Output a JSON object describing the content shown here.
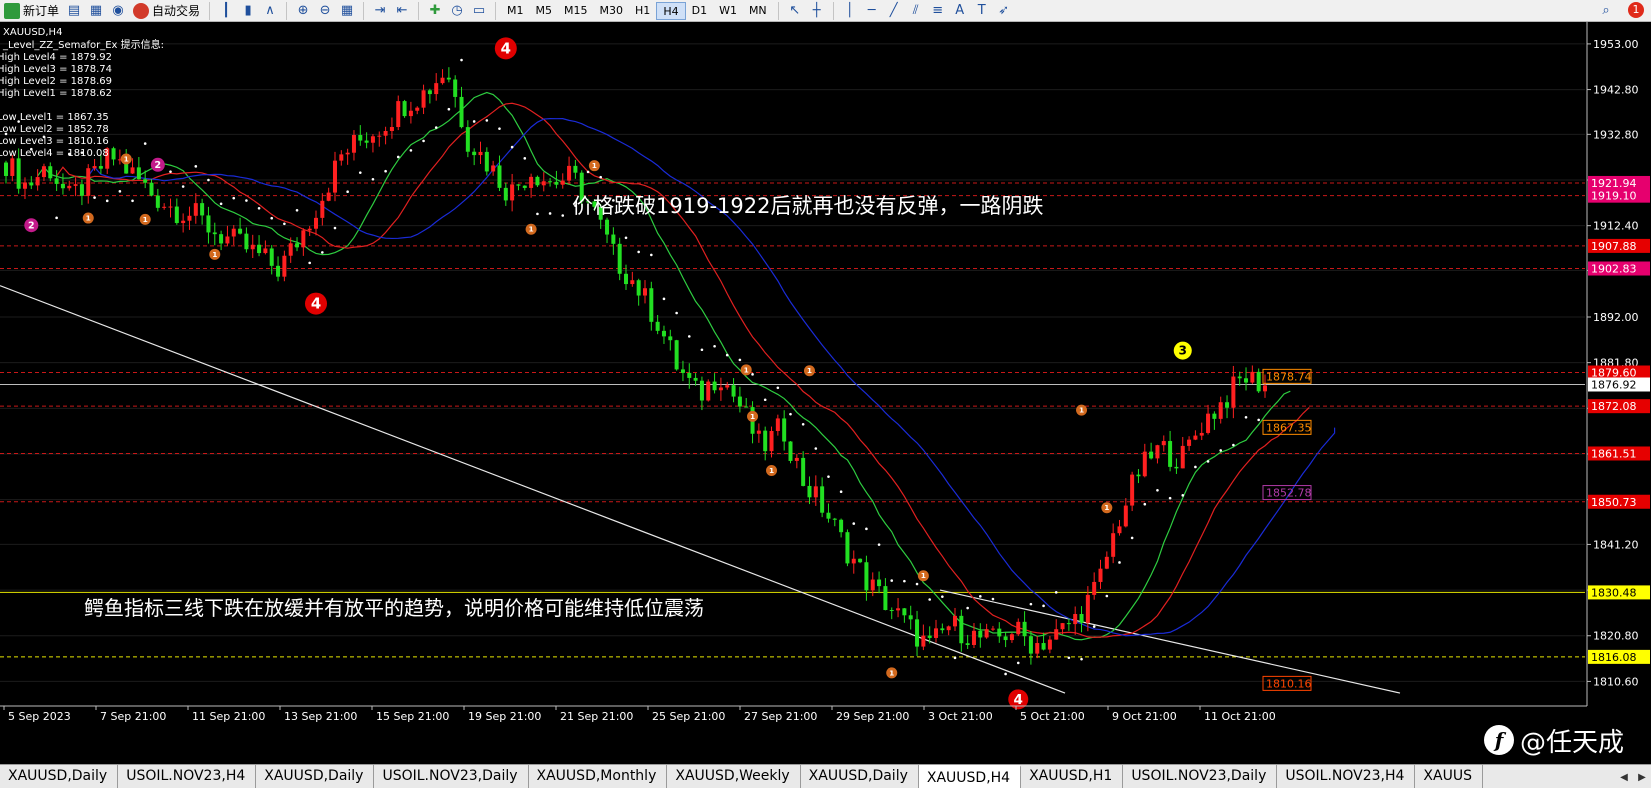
{
  "toolbar": {
    "new_order": "新订单",
    "auto_trading": "自动交易",
    "timeframes": [
      "M1",
      "M5",
      "M15",
      "M30",
      "H1",
      "H4",
      "D1",
      "W1",
      "MN"
    ],
    "active_timeframe": "H4",
    "notification_count": "1",
    "icons": [
      "new-order-icon",
      "market-watch-icon",
      "data-window-icon",
      "navigator-icon",
      "auto-trading-icon",
      "bar-chart-icon",
      "candlestick-icon",
      "line-chart-icon",
      "zoom-in-icon",
      "zoom-out-icon",
      "tile-windows-icon",
      "autoscroll-icon",
      "chart-shift-icon",
      "indicators-icon",
      "periods-icon",
      "templates-icon",
      "cursor-icon",
      "crosshair-icon",
      "vertical-line-icon",
      "horizontal-line-icon",
      "trendline-icon",
      "channel-icon",
      "fibonacci-icon",
      "text-icon",
      "text-label-icon",
      "arrows-icon",
      "search-icon"
    ]
  },
  "chart": {
    "symbol": "XAUUSD,H4",
    "indicator_name": "_Level_ZZ_Semafor_Ex 提示信息:",
    "indicator_lines": [
      "High Level4 = 1879.92",
      "High Level3 = 1878.74",
      "High Level2 = 1878.69",
      "High Level1 = 1878.62",
      "",
      "Low Level1 = 1867.35",
      "Low Level2 = 1852.78",
      "Low Level3 = 1810.16",
      "Low Level4 = 1810.08"
    ],
    "annotation_1": "价格跌破1919-1922后就再也没有反弹，一路阴跌",
    "annotation_2": "鳄鱼指标三线下跌在放缓并有放平的趋势，说明价格可能维持低位震荡",
    "price_axis": [
      "1953.00",
      "1942.80",
      "1932.80",
      "1922.60",
      "1912.40",
      "1902.40",
      "1892.00",
      "1881.80",
      "1871.60",
      "1861.40",
      "1851.20",
      "1841.20",
      "1831.00",
      "1820.80",
      "1810.60"
    ],
    "time_axis": [
      "5 Sep 2023",
      "7 Sep 21:00",
      "11 Sep 21:00",
      "13 Sep 21:00",
      "15 Sep 21:00",
      "19 Sep 21:00",
      "21 Sep 21:00",
      "25 Sep 21:00",
      "27 Sep 21:00",
      "29 Sep 21:00",
      "3 Oct 21:00",
      "5 Oct 21:00",
      "9 Oct 21:00",
      "11 Oct 21:00"
    ],
    "price_markers": [
      {
        "label": "1921.94",
        "color": "#e6006e"
      },
      {
        "label": "1919.10",
        "color": "#e6006e"
      },
      {
        "label": "1907.88",
        "color": "#e60000"
      },
      {
        "label": "1902.83",
        "color": "#e6006e"
      },
      {
        "label": "1879.60",
        "color": "#e60000"
      },
      {
        "label": "1876.92",
        "color": "#000000"
      },
      {
        "label": "1872.08",
        "color": "#e60000"
      },
      {
        "label": "1861.51",
        "color": "#e60000"
      },
      {
        "label": "1850.73",
        "color": "#e60000"
      },
      {
        "label": "1830.48",
        "color": "#ffff00"
      },
      {
        "label": "1816.08",
        "color": "#ffff00"
      }
    ],
    "semafor_labels": [
      {
        "label": "1878.74",
        "color": "#ff8c00"
      },
      {
        "label": "1867.35",
        "color": "#ff8c00"
      },
      {
        "label": "1852.78",
        "color": "#b23ba8"
      },
      {
        "label": "1810.16",
        "color": "#ff4500"
      }
    ],
    "semafor_numbers": [
      "4",
      "4",
      "3",
      "2",
      "2",
      "1"
    ]
  },
  "tabs": [
    {
      "label": "XAUUSD,Daily"
    },
    {
      "label": "USOIL.NOV23,H4"
    },
    {
      "label": "XAUUSD,Daily"
    },
    {
      "label": "USOIL.NOV23,Daily"
    },
    {
      "label": "XAUUSD,Monthly"
    },
    {
      "label": "XAUUSD,Weekly"
    },
    {
      "label": "XAUUSD,Daily"
    },
    {
      "label": "XAUUSD,H4",
      "active": true
    },
    {
      "label": "XAUUSD,H1"
    },
    {
      "label": "USOIL.NOV23,Daily"
    },
    {
      "label": "USOIL.NOV23,H4"
    },
    {
      "label": "XAUUS"
    }
  ],
  "watermark": {
    "logo": "f",
    "text": "@任天成"
  },
  "chart_data": {
    "type": "candlestick",
    "symbol": "XAUUSD",
    "timeframe": "H4",
    "ylim": [
      1806,
      1957
    ],
    "x_tick_labels": [
      "5 Sep 2023",
      "7 Sep 21:00",
      "11 Sep 21:00",
      "13 Sep 21:00",
      "15 Sep 21:00",
      "19 Sep 21:00",
      "21 Sep 21:00",
      "25 Sep 21:00",
      "27 Sep 21:00",
      "29 Sep 21:00",
      "3 Oct 21:00",
      "5 Oct 21:00",
      "9 Oct 21:00",
      "11 Oct 21:00"
    ],
    "close_path": [
      1926.5,
      1921.2,
      1925.8,
      1918.4,
      1922.6,
      1928.1,
      1924.0,
      1919.3,
      1916.2,
      1914.7,
      1910.8,
      1908.5,
      1905.9,
      1902.6,
      1909.8,
      1918.4,
      1928.2,
      1932.0,
      1935.1,
      1939.8,
      1942.3,
      1947.5,
      1931.8,
      1926.1,
      1919.6,
      1924.7,
      1922.1,
      1923.4,
      1915.6,
      1905.2,
      1899.4,
      1891.5,
      1880.8,
      1874.2,
      1879.6,
      1872.0,
      1862.5,
      1867.6,
      1855.3,
      1849.0,
      1840.6,
      1833.1,
      1827.9,
      1822.8,
      1818.2,
      1823.4,
      1820.8,
      1819.6,
      1822.3,
      1818.8,
      1820.7,
      1824.8,
      1831.6,
      1846.4,
      1857.7,
      1862.8,
      1860.1,
      1868.4,
      1873.1,
      1878.7,
      1876.9
    ],
    "semafor_points": [
      {
        "level": "4",
        "type": "high",
        "price": 1948.2
      },
      {
        "level": "4",
        "type": "low",
        "price": 1899.4
      },
      {
        "level": "3",
        "type": "high",
        "price": 1878.74
      },
      {
        "level": "4",
        "type": "low",
        "price": 1810.08
      }
    ]
  }
}
